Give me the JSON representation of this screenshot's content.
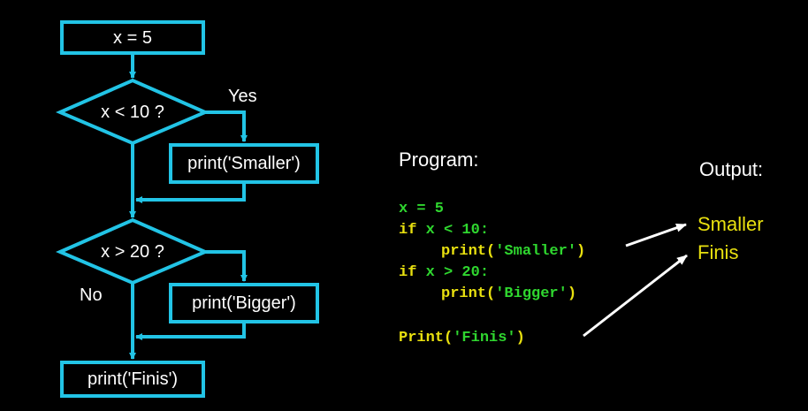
{
  "flowchart": {
    "assign": "x = 5",
    "decision1": "x < 10 ?",
    "yes_label": "Yes",
    "action1": "print('Smaller')",
    "decision2": "x > 20 ?",
    "no_label": "No",
    "action2": "print('Bigger')",
    "final": "print('Finis')"
  },
  "program": {
    "title": "Program:",
    "line1": "x = 5",
    "line2_kw": "if",
    "line2_rest": " x < 10:",
    "line3_fn": "print(",
    "line3_str": "'Smaller'",
    "line3_end": ")",
    "line4_kw": "if",
    "line4_rest": " x > 20:",
    "line5_fn": "print(",
    "line5_str": "'Bigger'",
    "line5_end": ")",
    "line7_fn": "Print(",
    "line7_str": "'Finis'",
    "line7_end": ")"
  },
  "output": {
    "title": "Output:",
    "lines": [
      "Smaller",
      "Finis"
    ]
  },
  "colors": {
    "flow": "#22c4e6",
    "keyword": "#e8e00f",
    "code_text": "#2fd62f",
    "output_text": "#e8e00f"
  }
}
